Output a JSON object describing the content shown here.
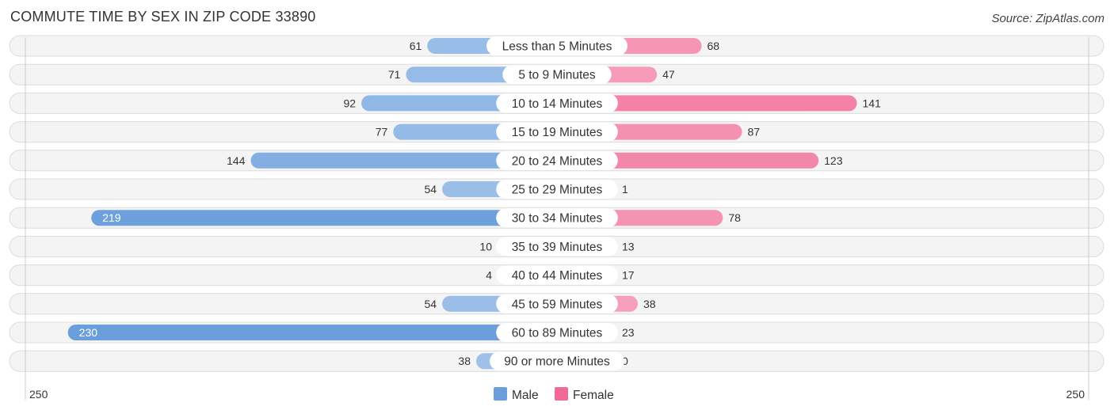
{
  "chart_data": {
    "type": "bar",
    "orientation": "horizontal-diverging",
    "title": "COMMUTE TIME BY SEX IN ZIP CODE 33890",
    "source": "Source: ZipAtlas.com",
    "categories": [
      "Less than 5 Minutes",
      "5 to 9 Minutes",
      "10 to 14 Minutes",
      "15 to 19 Minutes",
      "20 to 24 Minutes",
      "25 to 29 Minutes",
      "30 to 34 Minutes",
      "35 to 39 Minutes",
      "40 to 44 Minutes",
      "45 to 59 Minutes",
      "60 to 89 Minutes",
      "90 or more Minutes"
    ],
    "series": [
      {
        "name": "Male",
        "color": "#6a9fdc",
        "light_color": "#a9c8ec",
        "values": [
          61,
          71,
          92,
          77,
          144,
          54,
          219,
          10,
          4,
          54,
          230,
          38
        ]
      },
      {
        "name": "Female",
        "color": "#f06a95",
        "light_color": "#f7a9c1",
        "values": [
          68,
          47,
          141,
          87,
          123,
          1,
          78,
          13,
          17,
          38,
          23,
          0
        ]
      }
    ],
    "xlim": [
      -250,
      250
    ],
    "axis_tick_labels": {
      "left": "250",
      "right": "250"
    },
    "legend": {
      "position": "bottom-center",
      "items": [
        "Male",
        "Female"
      ]
    },
    "grid": false
  }
}
